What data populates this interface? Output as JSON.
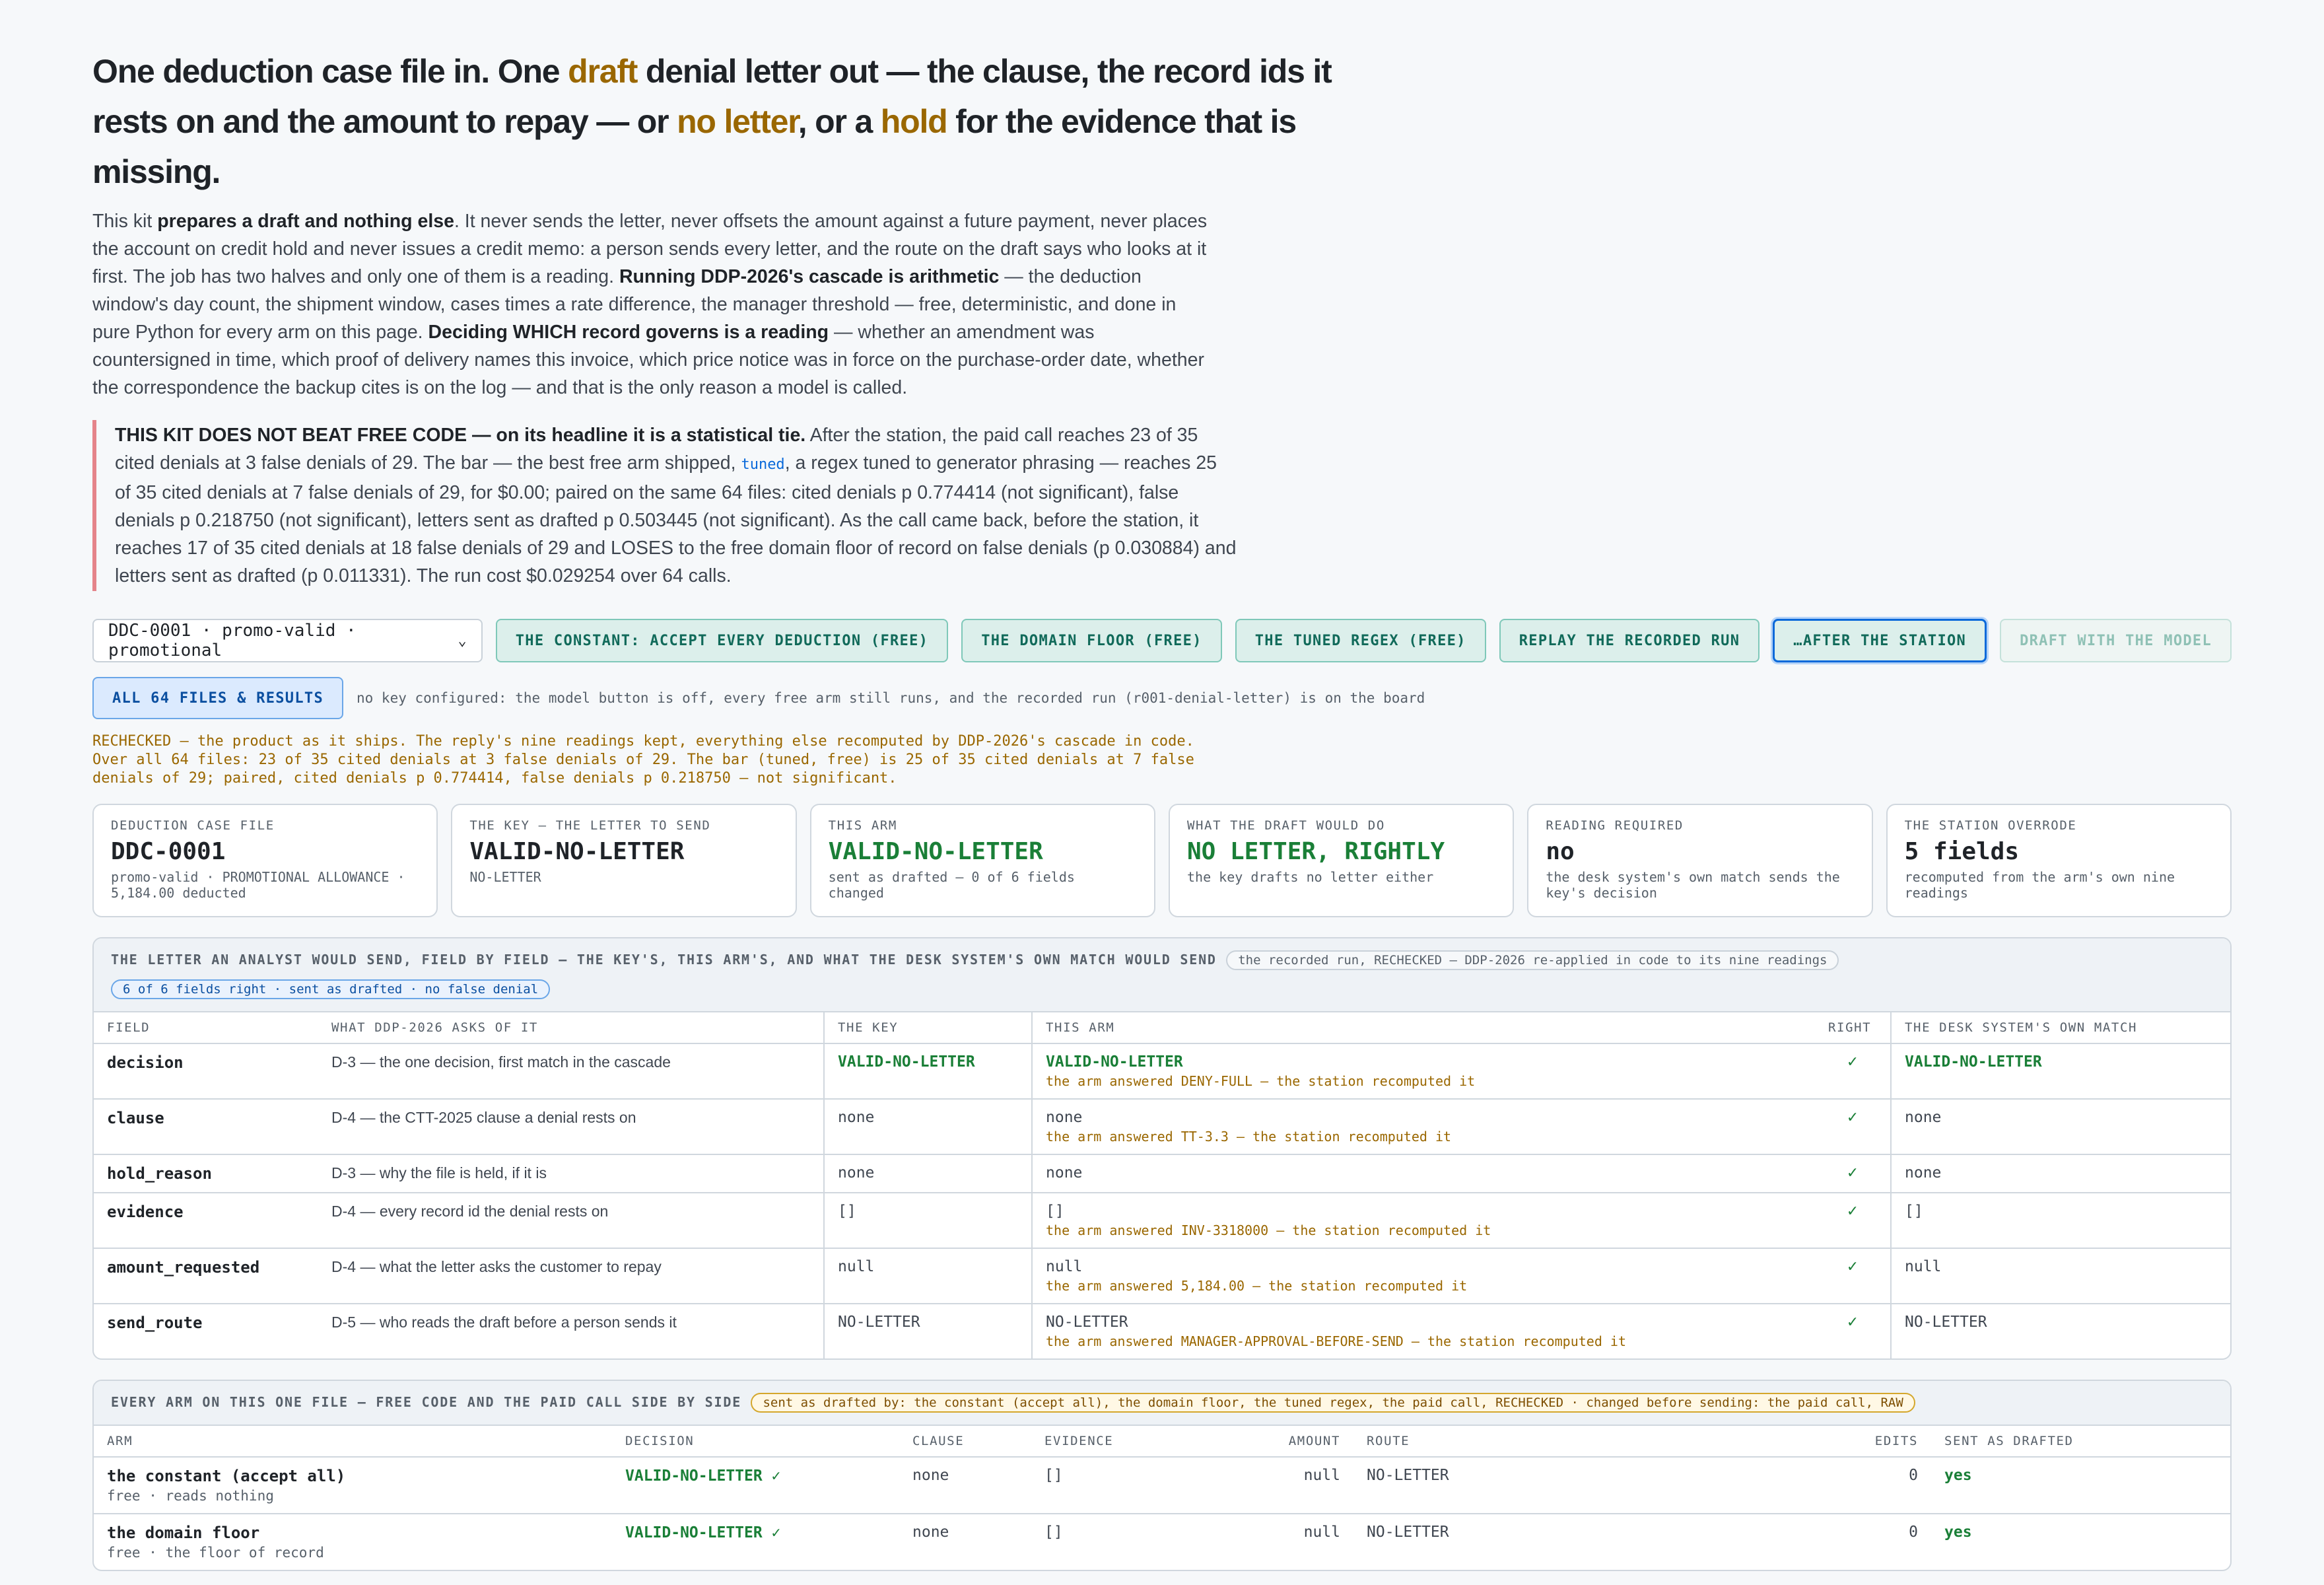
{
  "hero": {
    "p1": "One deduction case file in. One ",
    "hl1": "draft",
    "p2": " denial letter out — the clause, the record ids it rests on and the amount to repay — or ",
    "hl2": "no letter",
    "p3": ", or a ",
    "hl3": "hold",
    "p4": " for the evidence that is missing."
  },
  "intro": {
    "t1": "This kit ",
    "b1": "prepares a draft and nothing else",
    "t2": ". It never sends the letter, never offsets the amount against a future payment, never places the account on credit hold and never issues a credit memo: a person sends every letter, and the route on the draft says who looks at it first. The job has two halves and only one of them is a reading. ",
    "b2": "Running DDP-2026's cascade is arithmetic",
    "t3": " — the deduction window's day count, the shipment window, cases times a rate difference, the manager threshold — free, deterministic, and done in pure Python for every arm on this page. ",
    "b3": "Deciding WHICH record governs is a reading",
    "t4": " — whether an amendment was countersigned in time, which proof of delivery names this invoice, which price notice was in force on the purchase-order date, whether the correspondence the backup cites is on the log — and that is the only reason a model is called."
  },
  "callout": {
    "b1": "THIS KIT DOES NOT BEAT FREE CODE — on its headline it is a statistical tie.",
    "t1": " After the station, the paid call reaches 23 of 35 cited denials at 3 false denials of 29. The bar — the best free arm shipped, ",
    "code": "tuned",
    "t2": ", a regex tuned to generator phrasing — reaches 25 of 35 cited denials at 7 false denials of 29, for $0.00; paired on the same 64 files: cited denials p 0.774414 (not significant), false denials p 0.218750 (not significant), letters sent as drafted p 0.503445 (not significant). As the call came back, before the station, it reaches 17 of 35 cited denials at 18 false denials of 29 and LOSES to the free domain floor of record on false denials (p 0.030884) and letters sent as drafted (p 0.011331). The run cost $0.029254 over 64 calls."
  },
  "toolbar": {
    "select_value": "DDC-0001 · promo-valid · promotional",
    "buttons": [
      "THE CONSTANT: ACCEPT EVERY DEDUCTION (FREE)",
      "THE DOMAIN FLOOR (FREE)",
      "THE TUNED REGEX (FREE)",
      "REPLAY THE RECORDED RUN",
      "…AFTER THE STATION",
      "DRAFT WITH THE MODEL"
    ],
    "all_files": "ALL 64 FILES & RESULTS",
    "note": "no key configured: the model button is off, every free arm still runs, and the recorded run (r001-denial-letter) is on the board"
  },
  "status": "RECHECKED — the product as it ships. The reply's nine readings kept, everything else recomputed by DDP-2026's cascade in code.\nOver all 64 files: 23 of 35 cited denials at 3 false denials of 29. The bar (tuned, free) is 25 of 35 cited denials at 7 false\ndenials of 29; paired, cited denials p 0.774414, false denials p 0.218750 — not significant.",
  "cards": [
    {
      "label": "DEDUCTION CASE FILE",
      "value": "DDC-0001",
      "sub": "promo-valid · PROMOTIONAL ALLOWANCE · 5,184.00 deducted"
    },
    {
      "label": "THE KEY — THE LETTER TO SEND",
      "value": "VALID-NO-LETTER",
      "sub": "NO-LETTER"
    },
    {
      "label": "THIS ARM",
      "value": "VALID-NO-LETTER",
      "sub": "sent as drafted — 0 of 6 fields changed"
    },
    {
      "label": "WHAT THE DRAFT WOULD DO",
      "value": "NO LETTER, RIGHTLY",
      "sub": "the key drafts no letter either"
    },
    {
      "label": "READING REQUIRED",
      "value": "no",
      "sub": "the desk system's own match sends the key's decision"
    },
    {
      "label": "THE STATION OVERRODE",
      "value": "5 fields",
      "sub": "recomputed from the arm's own nine readings"
    }
  ],
  "letter": {
    "title": "THE LETTER AN ANALYST WOULD SEND, FIELD BY FIELD — THE KEY'S, THIS ARM'S, AND WHAT THE DESK SYSTEM'S OWN MATCH WOULD SEND",
    "pill": "the recorded run, RECHECKED — DDP-2026 re-applied in code to its nine readings",
    "summary": "6 of 6 fields right · sent as drafted · no false denial",
    "headers": [
      "FIELD",
      "WHAT DDP-2026 ASKS OF IT",
      "THE KEY",
      "THIS ARM",
      "RIGHT",
      "THE DESK SYSTEM'S OWN MATCH"
    ],
    "rows": [
      {
        "field": "decision",
        "asks": "D-3 — the one decision, first match in the cascade",
        "key": "VALID-NO-LETTER",
        "arm": "VALID-NO-LETTER",
        "note": "the arm answered DENY-FULL — the station recomputed it",
        "right": "✓",
        "desk": "VALID-NO-LETTER"
      },
      {
        "field": "clause",
        "asks": "D-4 — the CTT-2025 clause a denial rests on",
        "key": "none",
        "arm": "none",
        "note": "the arm answered TT-3.3 — the station recomputed it",
        "right": "✓",
        "desk": "none"
      },
      {
        "field": "hold_reason",
        "asks": "D-3 — why the file is held, if it is",
        "key": "none",
        "arm": "none",
        "note": "",
        "right": "✓",
        "desk": "none"
      },
      {
        "field": "evidence",
        "asks": "D-4 — every record id the denial rests on",
        "key": "[]",
        "arm": "[]",
        "note": "the arm answered INV-3318000 — the station recomputed it",
        "right": "✓",
        "desk": "[]"
      },
      {
        "field": "amount_requested",
        "asks": "D-4 — what the letter asks the customer to repay",
        "key": "null",
        "arm": "null",
        "note": "the arm answered 5,184.00 — the station recomputed it",
        "right": "✓",
        "desk": "null"
      },
      {
        "field": "send_route",
        "asks": "D-5 — who reads the draft before a person sends it",
        "key": "NO-LETTER",
        "arm": "NO-LETTER",
        "note": "the arm answered MANAGER-APPROVAL-BEFORE-SEND — the station recomputed it",
        "right": "✓",
        "desk": "NO-LETTER"
      }
    ]
  },
  "arms": {
    "title": "EVERY ARM ON THIS ONE FILE — FREE CODE AND THE PAID CALL SIDE BY SIDE",
    "pill": "sent as drafted by: the constant (accept all), the domain floor, the tuned regex, the paid call, RECHECKED · changed before sending: the paid call, RAW",
    "headers": [
      "ARM",
      "DECISION",
      "CLAUSE",
      "EVIDENCE",
      "AMOUNT",
      "ROUTE",
      "EDITS",
      "SENT AS DRAFTED"
    ],
    "rows": [
      {
        "name": "the constant (accept all)",
        "sub": "free · reads nothing",
        "decision": "VALID-NO-LETTER ✓",
        "clause": "none",
        "evidence": "[]",
        "amount": "null",
        "route": "NO-LETTER",
        "edits": "0",
        "sent": "yes"
      },
      {
        "name": "the domain floor",
        "sub": "free · the floor of record",
        "decision": "VALID-NO-LETTER ✓",
        "clause": "none",
        "evidence": "[]",
        "amount": "null",
        "route": "NO-LETTER",
        "edits": "0",
        "sent": "yes"
      }
    ]
  }
}
